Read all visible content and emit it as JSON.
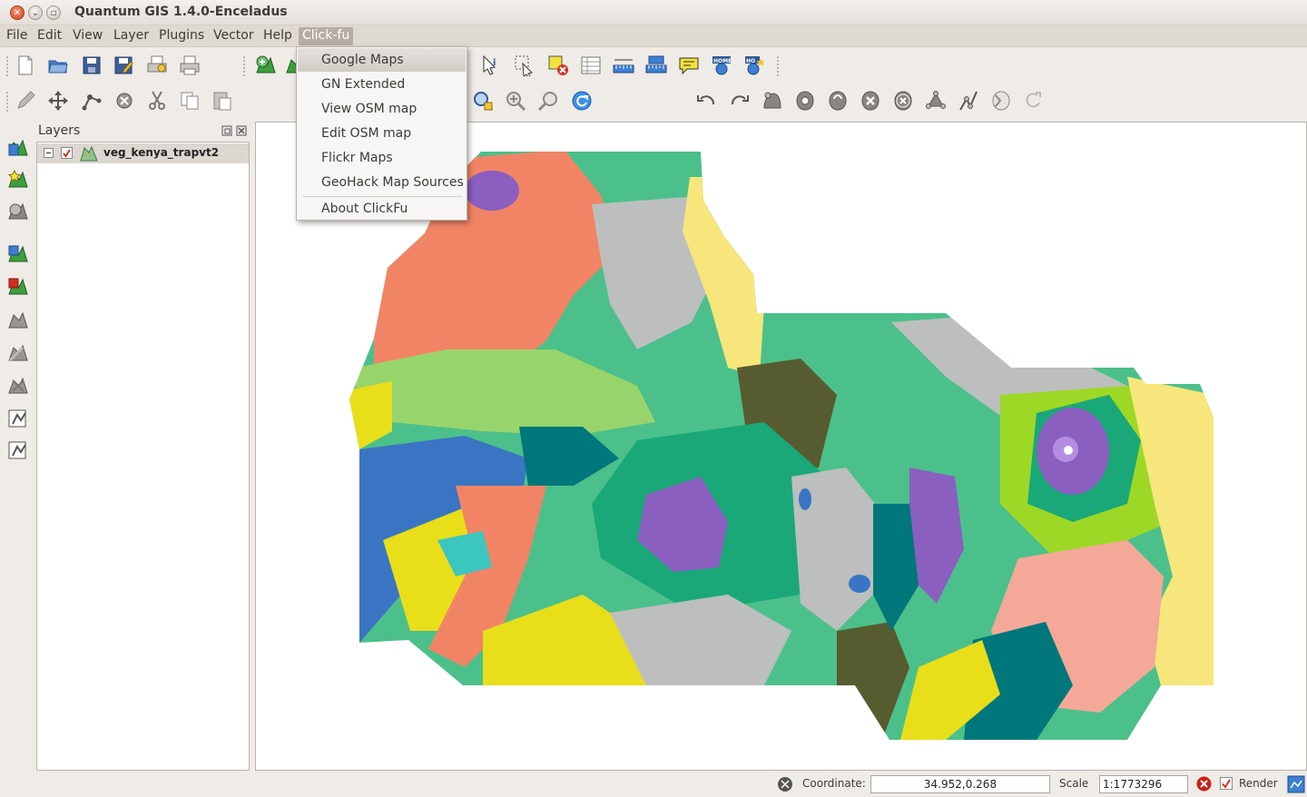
{
  "window": {
    "title": "Quantum GIS 1.4.0-Enceladus"
  },
  "menubar": {
    "items": [
      {
        "label": "File",
        "key": "F"
      },
      {
        "label": "Edit",
        "key": "E"
      },
      {
        "label": "View",
        "key": "V"
      },
      {
        "label": "Layer",
        "key": "L"
      },
      {
        "label": "Plugins",
        "key": "P"
      },
      {
        "label": "Vector",
        "key": "o"
      },
      {
        "label": "Help",
        "key": "H"
      },
      {
        "label": "Click-fu",
        "key": ""
      }
    ],
    "active": "Click-fu"
  },
  "dropdown": {
    "items": [
      {
        "label": "Google Maps",
        "highlighted": true
      },
      {
        "label": "GN Extended"
      },
      {
        "label": "View OSM map"
      },
      {
        "label": "Edit OSM map"
      },
      {
        "label": "Flickr Maps"
      },
      {
        "label": "GeoHack Map Sources"
      },
      {
        "label": "About ClickFu"
      }
    ]
  },
  "layers_panel": {
    "title": "Layers",
    "layers": [
      {
        "name": "veg_kenya_trapvt2",
        "visible": true
      }
    ]
  },
  "statusbar": {
    "coordinate_label": "Coordinate:",
    "coordinate_value": "34.952,0.268",
    "scale_label": "Scale",
    "scale_value": "1:1773296",
    "render_label": "Render",
    "render_checked": true
  },
  "map": {
    "palette": [
      "#4cc08a",
      "#f28466",
      "#98d46c",
      "#bcbfbe",
      "#8a5fc0",
      "#3a75c4",
      "#1aa878",
      "#00777a",
      "#575b30",
      "#e8de1a",
      "#f6e67c",
      "#9ed826",
      "#f4a898",
      "#3cc6c0"
    ]
  }
}
